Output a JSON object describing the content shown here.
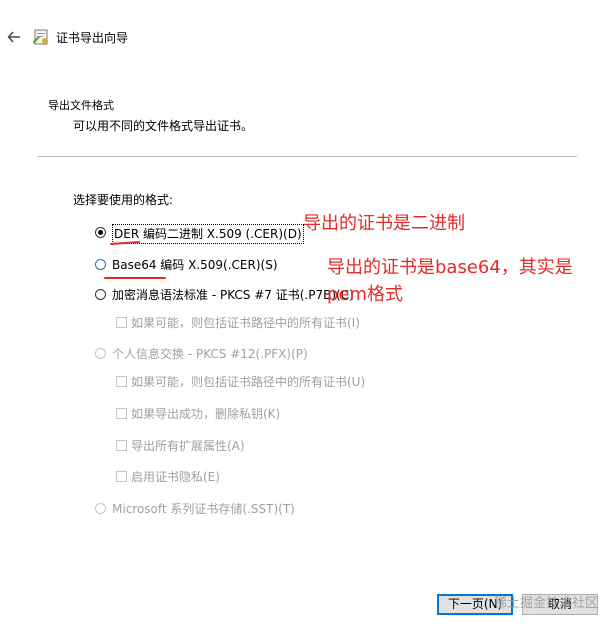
{
  "window": {
    "title": "证书导出向导"
  },
  "header": {
    "title": "导出文件格式",
    "description": "可以用不同的文件格式导出证书。"
  },
  "section_label": "选择要使用的格式:",
  "options": {
    "der": "DER 编码二进制 X.509 (.CER)(D)",
    "base64": "Base64 编码 X.509(.CER)(S)",
    "pkcs7": "加密消息语法标准 - PKCS #7 证书(.P7B)(C)",
    "pkcs7_include_chain": "如果可能，则包括证书路径中的所有证书(I)",
    "pfx": "个人信息交换 - PKCS #12(.PFX)(P)",
    "pfx_include_chain": "如果可能，则包括证书路径中的所有证书(U)",
    "pfx_delete_key": "如果导出成功，删除私钥(K)",
    "pfx_export_ext": "导出所有扩展属性(A)",
    "pfx_privacy": "启用证书隐私(E)",
    "sst": "Microsoft 系列证书存储(.SST)(T)"
  },
  "annotations": {
    "der_note": "导出的证书是二进制",
    "base64_note_line1": "导出的证书是base64，其实是",
    "base64_note_line2": "pem格式"
  },
  "buttons": {
    "next": "下一页(N)",
    "cancel": "取消"
  },
  "watermark": "稀土掘金技术社区",
  "colors": {
    "annotation": "#e52a2a",
    "accent": "#0078d7"
  }
}
